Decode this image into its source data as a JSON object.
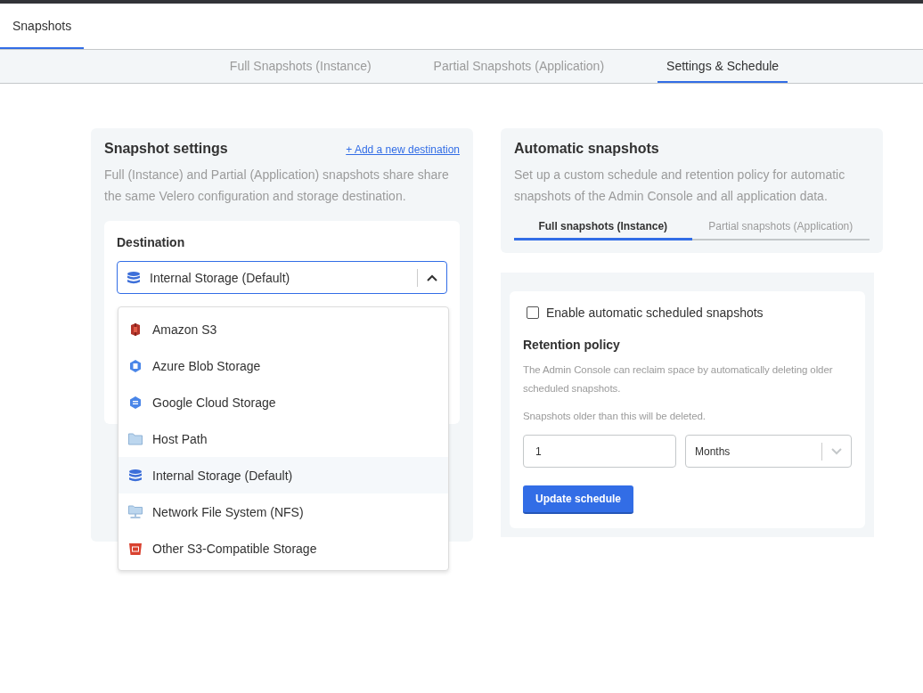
{
  "top_tabs": [
    {
      "label": "Snapshots",
      "selected": true
    }
  ],
  "sub_tabs": [
    {
      "label": "Full Snapshots (Instance)",
      "selected": false
    },
    {
      "label": "Partial Snapshots (Application)",
      "selected": false
    },
    {
      "label": "Settings & Schedule",
      "selected": true
    }
  ],
  "snapshot_settings": {
    "title": "Snapshot settings",
    "link": "+ Add a new destination",
    "description": "Full (Instance) and Partial (Application) snapshots share share the same Velero configuration and storage destination.",
    "destination": {
      "label": "Destination",
      "value": "Internal Storage (Default)",
      "expanded": true,
      "options": [
        {
          "label": "Amazon S3",
          "kind": "aws",
          "selected": false
        },
        {
          "label": "Azure Blob Storage",
          "kind": "azure",
          "selected": false
        },
        {
          "label": "Google Cloud Storage",
          "kind": "gcs",
          "selected": false
        },
        {
          "label": "Host Path",
          "kind": "folder",
          "selected": false
        },
        {
          "label": "Internal Storage (Default)",
          "kind": "internal",
          "selected": true
        },
        {
          "label": "Network File System (NFS)",
          "kind": "nfs",
          "selected": false
        },
        {
          "label": "Other S3-Compatible Storage",
          "kind": "s3",
          "selected": false
        }
      ]
    }
  },
  "automatic_snapshots": {
    "title": "Automatic snapshots",
    "description": "Set up a custom schedule and retention policy for automatic snapshots of the Admin Console and all application data.",
    "tabs": [
      {
        "label": "Full snapshots (Instance)",
        "selected": true
      },
      {
        "label": "Partial snapshots (Application)",
        "selected": false
      }
    ],
    "enable_checkbox": {
      "label": "Enable automatic scheduled snapshots",
      "checked": false
    },
    "retention": {
      "title": "Retention policy",
      "description": "The Admin Console can reclaim space by automatically deleting older scheduled snapshots.",
      "hint": "Snapshots older than this will be deleted.",
      "amount": "1",
      "unit": "Months"
    },
    "button": "Update schedule"
  }
}
